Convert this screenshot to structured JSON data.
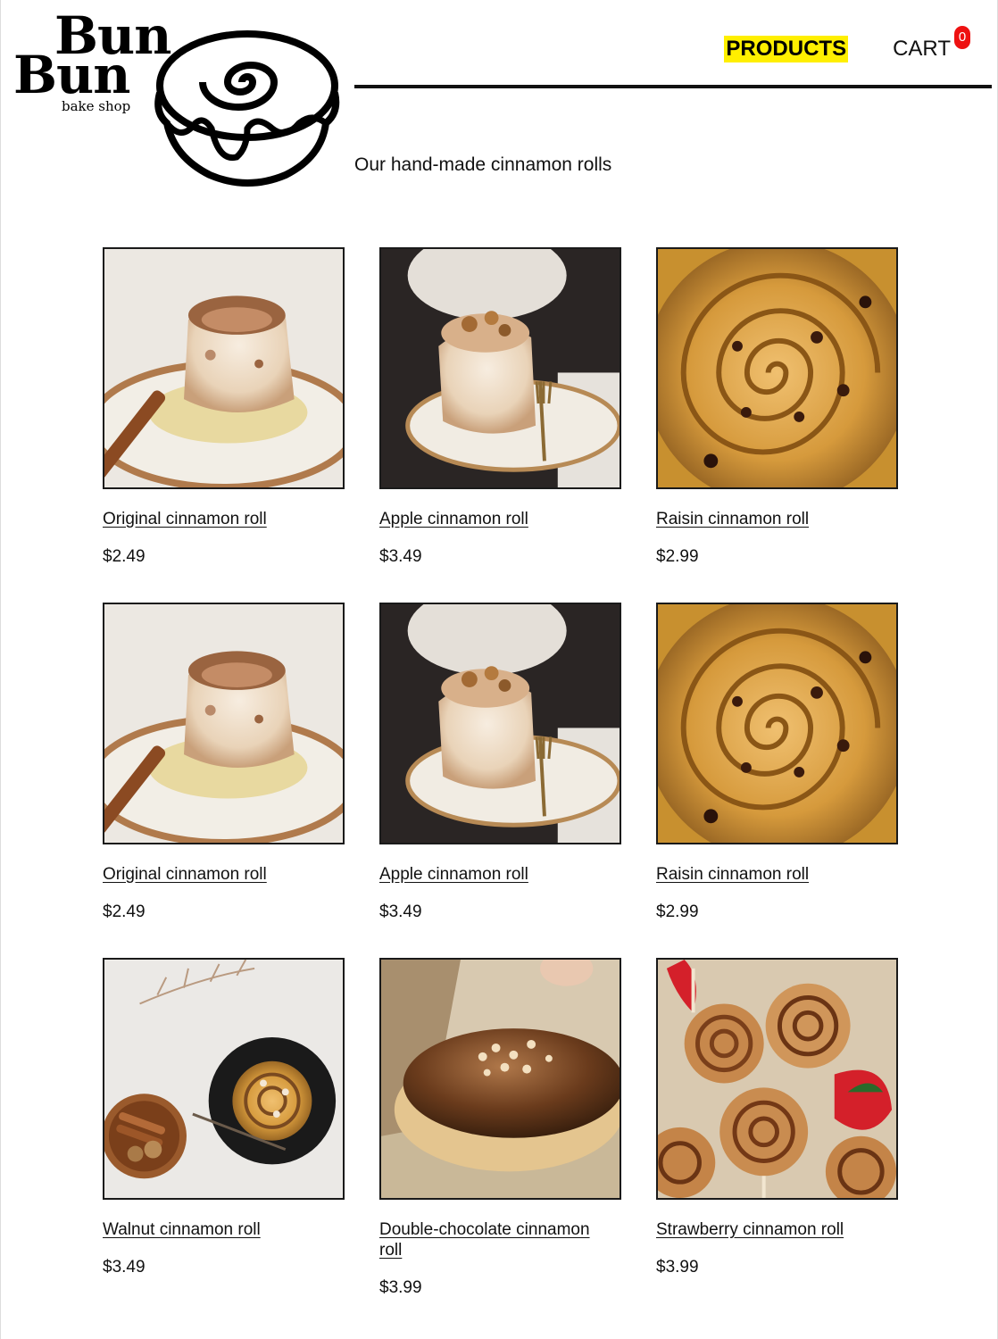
{
  "brand": {
    "line1": "Bun",
    "line2": "Bun",
    "subtitle": "bake shop"
  },
  "nav": {
    "products": "PRODUCTS",
    "cart": "CART",
    "cart_count": "0"
  },
  "tagline": "Our hand-made cinnamon rolls",
  "colors": {
    "highlight": "#ffef00",
    "badge": "#ee1111",
    "rule": "#111111"
  },
  "products": [
    {
      "name": "Original cinnamon roll",
      "price": "$2.49",
      "image": "original-roll-photo"
    },
    {
      "name": "Apple cinnamon roll",
      "price": "$3.49",
      "image": "apple-roll-photo"
    },
    {
      "name": "Raisin cinnamon roll",
      "price": "$2.99",
      "image": "raisin-roll-photo"
    },
    {
      "name": "Original cinnamon roll",
      "price": "$2.49",
      "image": "original-roll-photo"
    },
    {
      "name": "Apple cinnamon roll",
      "price": "$3.49",
      "image": "apple-roll-photo"
    },
    {
      "name": "Raisin cinnamon roll",
      "price": "$2.99",
      "image": "raisin-roll-photo"
    },
    {
      "name": "Walnut cinnamon roll",
      "price": "$3.49",
      "image": "walnut-roll-photo"
    },
    {
      "name": "Double-chocolate cinnamon roll",
      "price": "$3.99",
      "image": "double-chocolate-roll-photo"
    },
    {
      "name": "Strawberry cinnamon roll",
      "price": "$3.99",
      "image": "strawberry-roll-photo"
    }
  ]
}
